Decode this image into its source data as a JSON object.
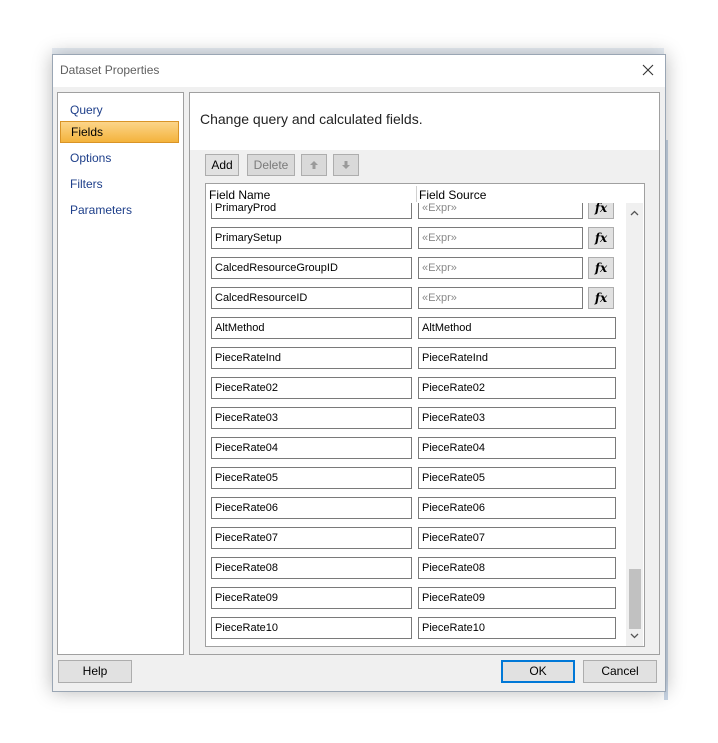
{
  "window": {
    "title": "Dataset Properties"
  },
  "nav": {
    "items": [
      {
        "label": "Query",
        "selected": false
      },
      {
        "label": "Fields",
        "selected": true
      },
      {
        "label": "Options",
        "selected": false
      },
      {
        "label": "Filters",
        "selected": false
      },
      {
        "label": "Parameters",
        "selected": false
      }
    ]
  },
  "main": {
    "heading": "Change query and calculated fields.",
    "toolbar": {
      "add_label": "Add",
      "delete_label": "Delete"
    },
    "grid": {
      "col_field_name": "Field Name",
      "col_field_source": "Field Source",
      "fx_label": "fx",
      "rows": [
        {
          "name": "PrimaryProd",
          "source": "«Expr»",
          "calculated": true
        },
        {
          "name": "PrimarySetup",
          "source": "«Expr»",
          "calculated": true
        },
        {
          "name": "CalcedResourceGroupID",
          "source": "«Expr»",
          "calculated": true
        },
        {
          "name": "CalcedResourceID",
          "source": "«Expr»",
          "calculated": true
        },
        {
          "name": "AltMethod",
          "source": "AltMethod",
          "calculated": false
        },
        {
          "name": "PieceRateInd",
          "source": "PieceRateInd",
          "calculated": false
        },
        {
          "name": "PieceRate02",
          "source": "PieceRate02",
          "calculated": false
        },
        {
          "name": "PieceRate03",
          "source": "PieceRate03",
          "calculated": false
        },
        {
          "name": "PieceRate04",
          "source": "PieceRate04",
          "calculated": false
        },
        {
          "name": "PieceRate05",
          "source": "PieceRate05",
          "calculated": false
        },
        {
          "name": "PieceRate06",
          "source": "PieceRate06",
          "calculated": false
        },
        {
          "name": "PieceRate07",
          "source": "PieceRate07",
          "calculated": false
        },
        {
          "name": "PieceRate08",
          "source": "PieceRate08",
          "calculated": false
        },
        {
          "name": "PieceRate09",
          "source": "PieceRate09",
          "calculated": false
        },
        {
          "name": "PieceRate10",
          "source": "PieceRate10",
          "calculated": false
        }
      ]
    }
  },
  "footer": {
    "help_label": "Help",
    "ok_label": "OK",
    "cancel_label": "Cancel"
  },
  "colors": {
    "nav_selected": "#f4b33c",
    "link_text": "#1e3f8a",
    "default_button_border": "#0078d7"
  }
}
